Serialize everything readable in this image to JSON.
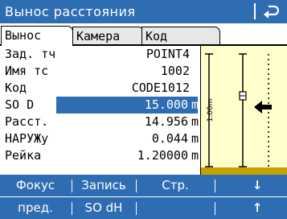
{
  "title": "Вынос расстояния",
  "icons": {
    "back": "return-arrow-icon",
    "direction": "left-arrow-icon"
  },
  "tabs": [
    {
      "label": "Вынос",
      "active": true
    },
    {
      "label": "Камера",
      "active": false
    },
    {
      "label": "Код",
      "active": false
    }
  ],
  "rows": [
    {
      "label": "Зад. тч",
      "value": "POINT4",
      "unit": ""
    },
    {
      "label": "Имя тс",
      "value": "1002",
      "unit": ""
    },
    {
      "label": "Код",
      "value": "CODE1012",
      "unit": ""
    },
    {
      "label": "SO D",
      "value": "15.000",
      "unit": "m"
    },
    {
      "label": "Расст.",
      "value": "14.956",
      "unit": "m"
    },
    {
      "label": "НАРУЖу",
      "value": "0.044",
      "unit": "m"
    },
    {
      "label": "Рейка",
      "value": "1.20000",
      "unit": "m"
    }
  ],
  "graphic": {
    "scale_label": "1.00m"
  },
  "softkeys_row1": [
    "Фокус",
    "Запись",
    "Стр.",
    "",
    "↓"
  ],
  "softkeys_row2": [
    "пред.",
    "SO dH",
    "",
    "",
    "↑"
  ],
  "colors": {
    "accent": "#2f6db3",
    "panel": "#ffffcc",
    "ground": "#c8a000"
  }
}
